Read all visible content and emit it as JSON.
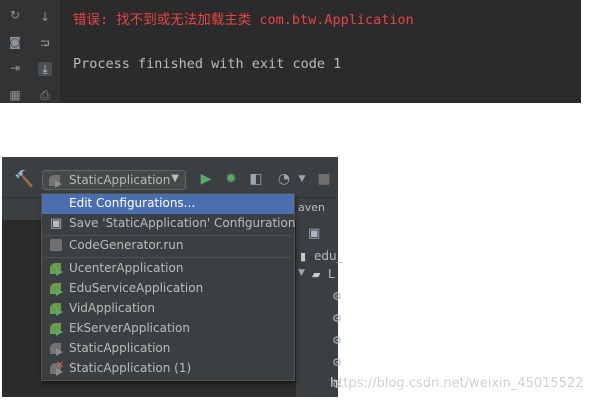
{
  "console": {
    "error_line": "错误: 找不到或无法加载主类 com.btw.Application",
    "process_line": "Process finished with exit code 1",
    "gutter_icons": [
      "rerun-icon",
      "down-arrow-icon",
      "camera-icon",
      "soft-wrap-icon",
      "login-icon",
      "scroll-to-end-icon",
      "layout-icon",
      "print-icon"
    ]
  },
  "toolbar": {
    "build_icon": "hammer-icon",
    "run_config_label": "StaticApplication",
    "run_icon": "play-icon",
    "debug_icon": "bug-icon",
    "coverage_icon": "coverage-icon",
    "profile_icon": "profile-icon",
    "stop_icon": "stop-icon",
    "tab_fragment": "aven"
  },
  "tree": {
    "item_fragment": "edu_",
    "item_fragment2": "L"
  },
  "menu": {
    "items": [
      {
        "label": "Edit Configurations...",
        "icon": "none",
        "selected": true
      },
      {
        "label": "Save 'StaticApplication' Configuration",
        "icon": "save-icon"
      },
      {
        "label": "CodeGenerator.run",
        "icon": "java-run-icon"
      },
      {
        "label": "UcenterApplication",
        "icon": "spring-boot-icon"
      },
      {
        "label": "EduServiceApplication",
        "icon": "spring-boot-icon"
      },
      {
        "label": "VidApplication",
        "icon": "spring-boot-icon"
      },
      {
        "label": "EkServerApplication",
        "icon": "spring-boot-icon"
      },
      {
        "label": "StaticApplication",
        "icon": "spring-boot-icon"
      },
      {
        "label": "StaticApplication (1)",
        "icon": "spring-boot-error-icon"
      }
    ]
  },
  "watermark": "https://blog.csdn.net/weixin_45015522",
  "colors": {
    "console_bg": "#2b2b2b",
    "error_text": "#e64545",
    "selection": "#4b6eaf",
    "ide_bg": "#3c3f41"
  }
}
